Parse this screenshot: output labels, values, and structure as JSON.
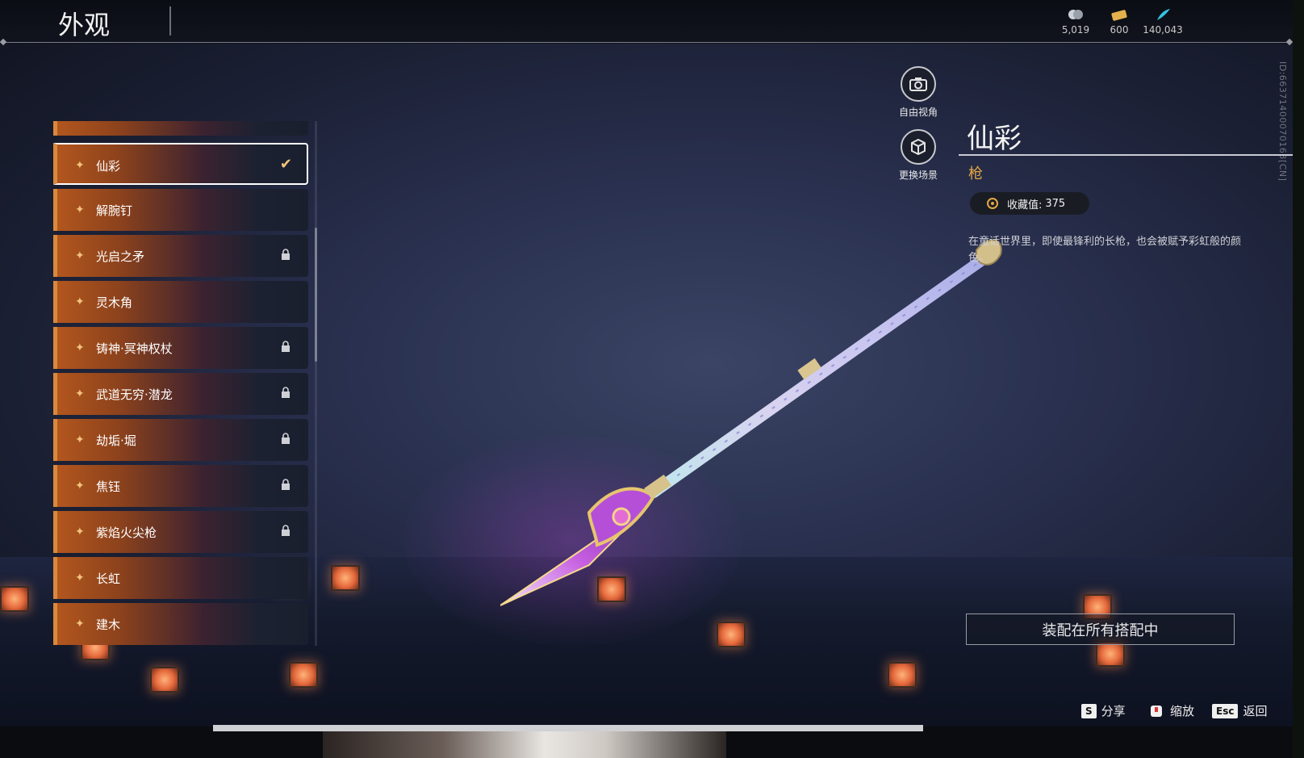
{
  "header": {
    "title": "外观"
  },
  "currencies": [
    {
      "icon": "coin-icon",
      "value": "5,019"
    },
    {
      "icon": "ticket-icon",
      "value": "600"
    },
    {
      "icon": "feather-icon",
      "value": "140,043"
    }
  ],
  "side_id": "ID:663714000701​63[CN]",
  "list": {
    "items": [
      {
        "label": "仙彩",
        "state": "selected"
      },
      {
        "label": "解腕钉",
        "state": "normal"
      },
      {
        "label": "光启之矛",
        "state": "locked"
      },
      {
        "label": "灵木角",
        "state": "normal"
      },
      {
        "label": "铸神·冥神权杖",
        "state": "locked"
      },
      {
        "label": "武道无穷·潜龙",
        "state": "locked"
      },
      {
        "label": "劫垢·堀",
        "state": "locked"
      },
      {
        "label": "焦钰",
        "state": "locked"
      },
      {
        "label": "紫焰火尖枪",
        "state": "locked"
      },
      {
        "label": "长虹",
        "state": "normal"
      },
      {
        "label": "建木",
        "state": "normal"
      }
    ]
  },
  "view_buttons": {
    "free_camera": "自由视角",
    "change_scene": "更换场景"
  },
  "detail": {
    "name": "仙彩",
    "type": "枪",
    "collection_label": "收藏值:",
    "collection_value": "375",
    "description": "在童话世界里，即使最锋利的长枪，也会被赋予彩虹般的颜色。",
    "equip_button": "装配在所有搭配中"
  },
  "hints": {
    "share_key": "S",
    "share_label": "分享",
    "zoom_label": "缩放",
    "back_key": "Esc",
    "back_label": "返回"
  },
  "colors": {
    "accent_orange": "#d9893d",
    "type_gold": "#e2a843"
  }
}
